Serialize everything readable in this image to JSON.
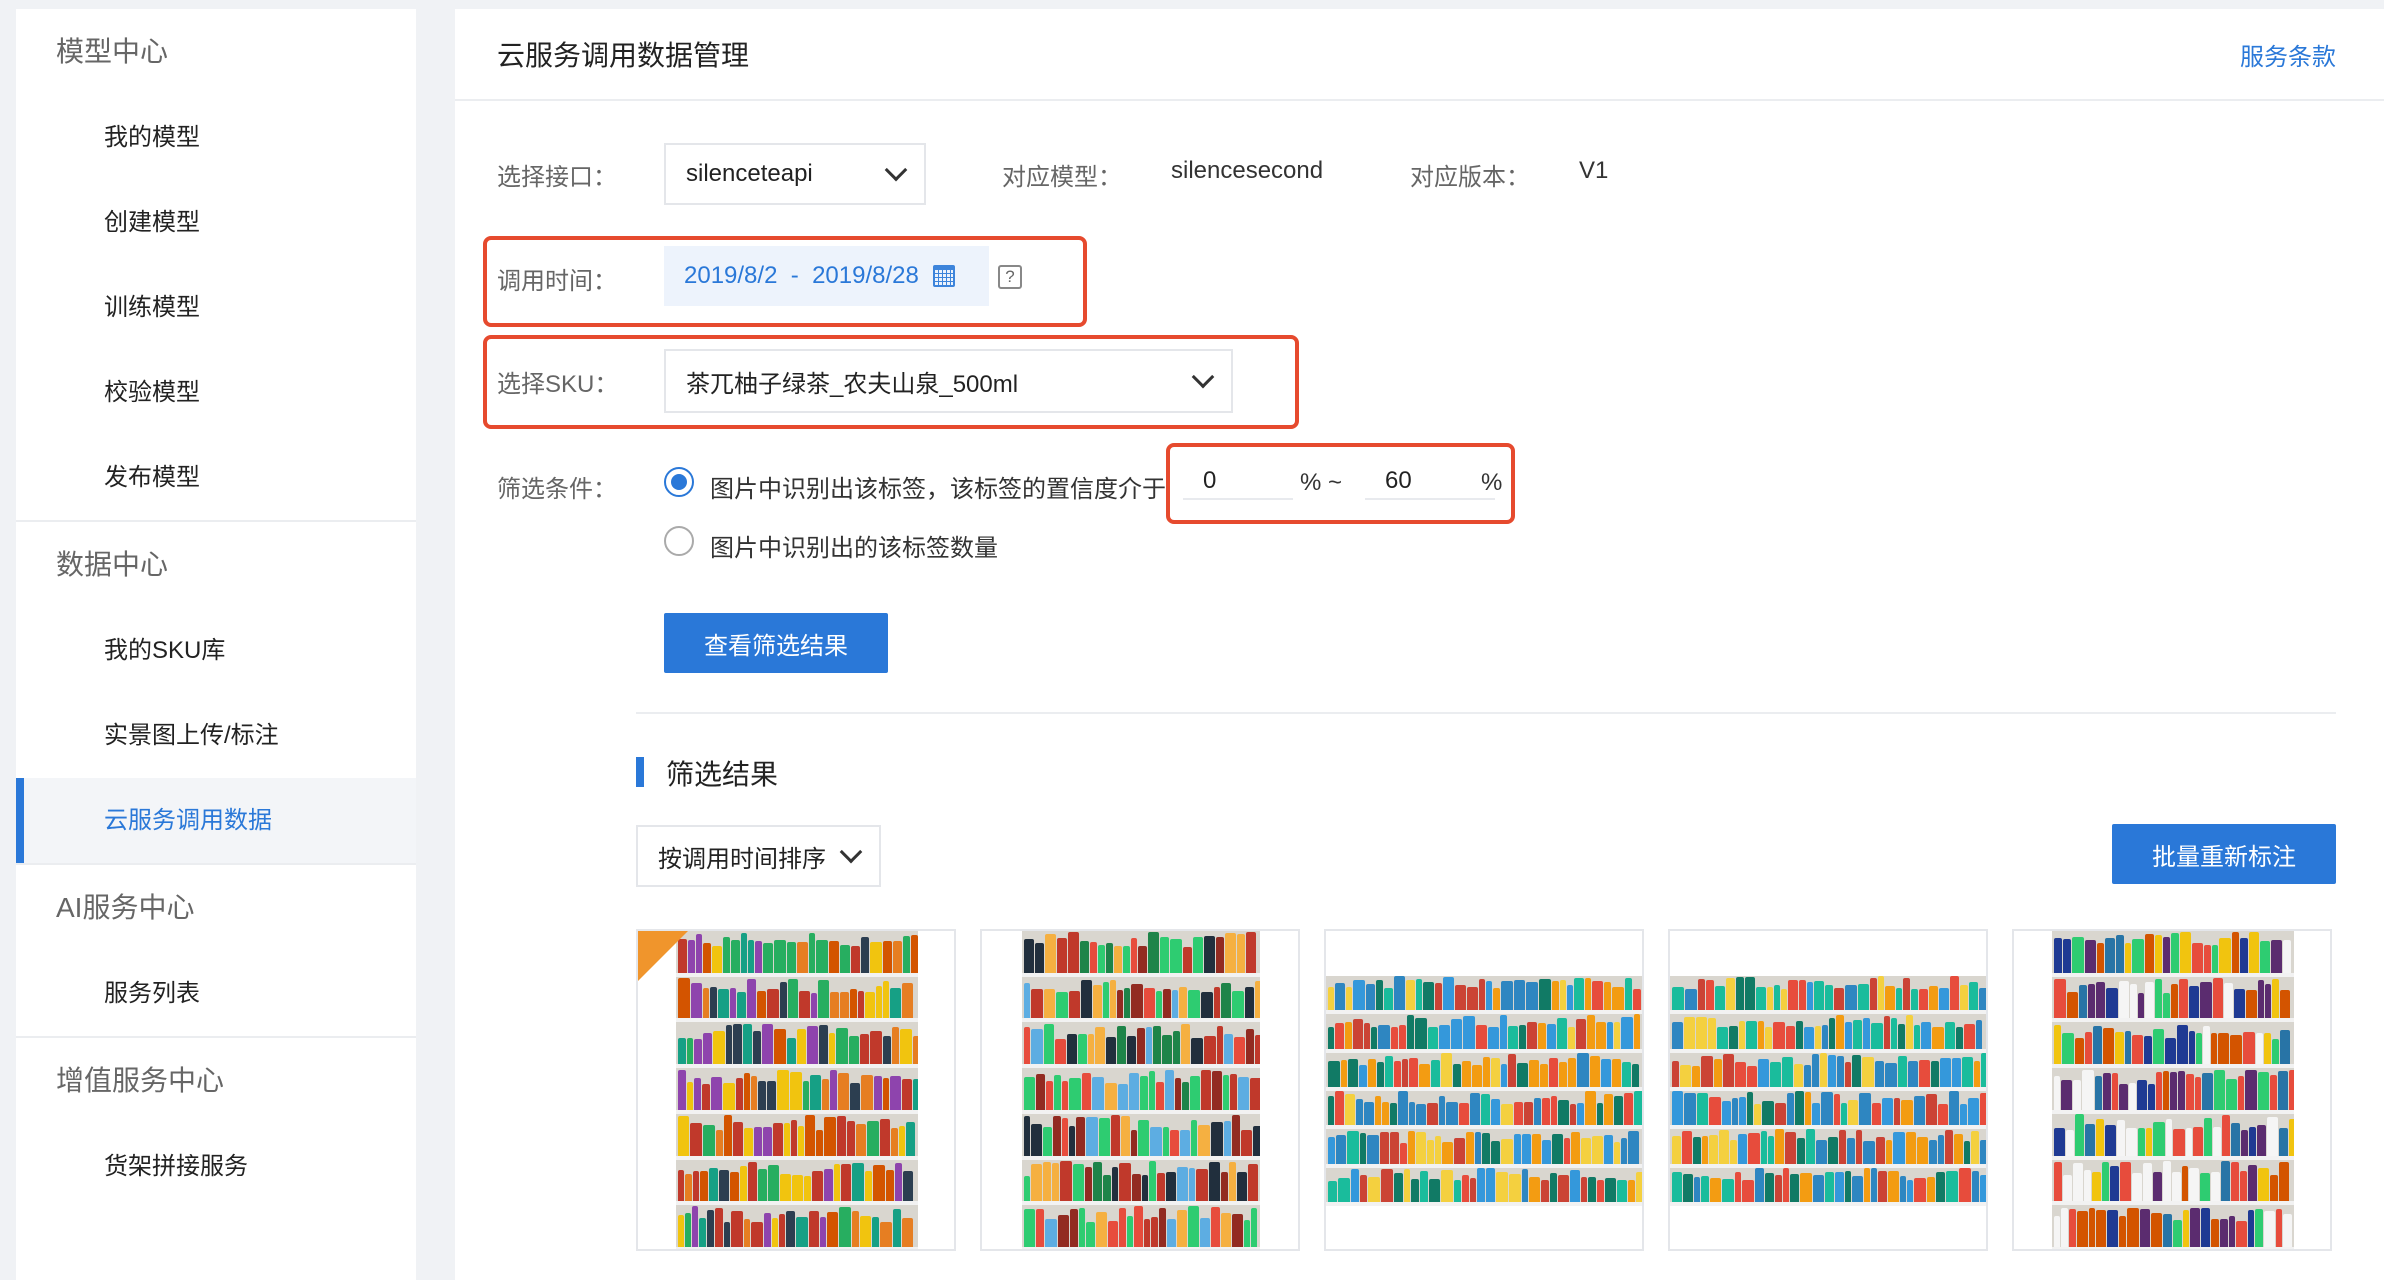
{
  "sidebar": {
    "sections": [
      {
        "title": "模型中心",
        "items": [
          "我的模型",
          "创建模型",
          "训练模型",
          "校验模型",
          "发布模型"
        ]
      },
      {
        "title": "数据中心",
        "items": [
          "我的SKU库",
          "实景图上传/标注",
          "云服务调用数据"
        ]
      },
      {
        "title": "AI服务中心",
        "items": [
          "服务列表"
        ]
      },
      {
        "title": "增值服务中心",
        "items": [
          "货架拼接服务"
        ]
      }
    ],
    "active_item": "云服务调用数据"
  },
  "header": {
    "title": "云服务调用数据管理",
    "terms_link": "服务条款"
  },
  "form": {
    "api_label": "选择接口：",
    "api_value": "silenceteapi",
    "model_label": "对应模型：",
    "model_value": "silencesecond",
    "version_label": "对应版本：",
    "version_value": "V1",
    "time_label": "调用时间：",
    "date_range": "2019/8/2  -  2019/8/28",
    "help_icon_text": "?",
    "sku_label": "选择SKU：",
    "sku_value": "茶兀柚子绿茶_农夫山泉_500ml",
    "filter_label": "筛选条件：",
    "option1_text": "图片中识别出该标签，该标签的置信度介于",
    "option2_text": "图片中识别出的该标签数量",
    "min_value": "0",
    "max_value": "60",
    "percent_sign": "%",
    "range_sep": "% ~",
    "selected_option": 1,
    "submit_button": "查看筛选结果"
  },
  "results": {
    "title": "筛选结果",
    "sort_label": "按调用时间排序",
    "batch_button": "批量重新标注",
    "thumbnails": [
      {
        "icon": "shelf-photo",
        "flagged": true
      },
      {
        "icon": "shelf-photo",
        "flagged": false
      },
      {
        "icon": "shelf-photo",
        "flagged": false
      },
      {
        "icon": "shelf-photo",
        "flagged": false
      },
      {
        "icon": "shelf-photo",
        "flagged": false
      }
    ]
  },
  "colors": {
    "accent": "#2a78d8",
    "highlight": "#e64a2e",
    "flag": "#f0952c"
  }
}
